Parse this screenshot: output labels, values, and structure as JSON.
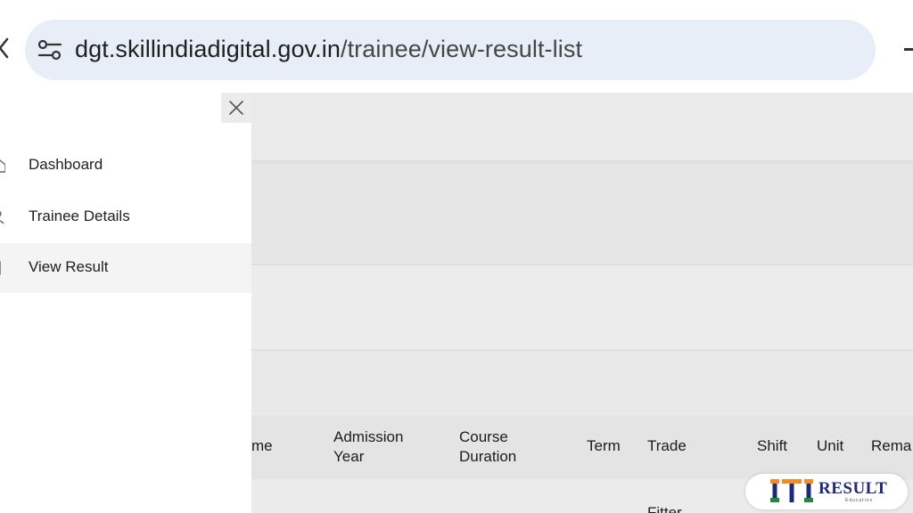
{
  "browser": {
    "url_host": "dgt.skillindiadigital.gov.in",
    "url_path": "/trainee/view-result-list"
  },
  "sidebar": {
    "items": [
      {
        "label": "Dashboard",
        "icon": "home-icon",
        "active": false
      },
      {
        "label": "Trainee Details",
        "icon": "user-icon",
        "active": false
      },
      {
        "label": "View Result",
        "icon": "document-icon",
        "active": true
      }
    ]
  },
  "table": {
    "columns": [
      "me",
      "Admission Year",
      "Course Duration",
      "Term",
      "Trade",
      "Shift",
      "Unit",
      "Rema"
    ],
    "rows": [
      {
        "trade": "Fitter"
      }
    ]
  },
  "watermark": {
    "mark": "ITI",
    "word": "RESULT",
    "sub": "Education"
  },
  "colors": {
    "url_pill": "#e8eef7",
    "overlay": "#ebebeb",
    "logo_saffron": "#f28c28",
    "logo_green": "#1f8a3a",
    "logo_navy": "#1e2a78"
  }
}
